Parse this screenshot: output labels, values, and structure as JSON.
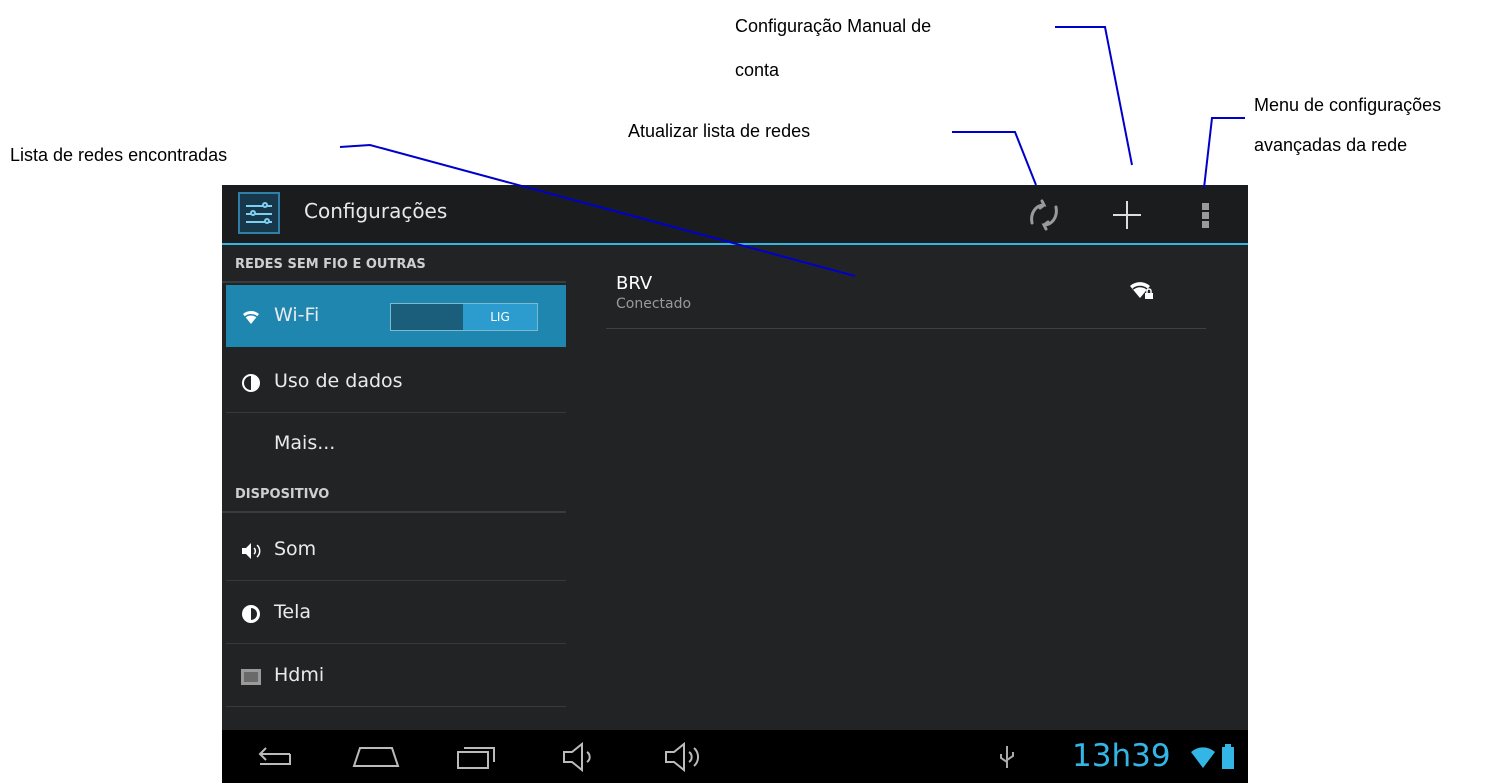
{
  "annotations": {
    "manual_config": "Configuração Manual de",
    "manual_config_line2": "conta",
    "refresh": "Atualizar lista de redes",
    "menu": "Menu de configurações",
    "menu_line2": "avançadas da rede",
    "network_list": "Lista de redes encontradas"
  },
  "action_bar": {
    "title": "Configurações",
    "icons": [
      "settings-app-icon",
      "refresh-icon",
      "add-icon",
      "overflow-menu-icon"
    ]
  },
  "sidebar": {
    "categories": [
      {
        "label": "REDES SEM FIO E OUTRAS"
      },
      {
        "label": "DISPOSITIVO"
      }
    ],
    "items": [
      {
        "label": "Wi-Fi",
        "icon": "wifi-icon",
        "selected": true,
        "toggle": "LIG"
      },
      {
        "label": "Uso de dados",
        "icon": "data-usage-icon"
      },
      {
        "label": "Mais..."
      },
      {
        "label": "Som",
        "icon": "speaker-icon"
      },
      {
        "label": "Tela",
        "icon": "display-brightness-icon"
      },
      {
        "label": "Hdmi",
        "icon": "hdmi-icon"
      }
    ]
  },
  "networks": [
    {
      "ssid": "BRV",
      "status": "Conectado",
      "icon": "wifi-locked-icon"
    }
  ],
  "status_bar": {
    "time": "13h39",
    "icons": [
      "back-icon",
      "home-icon",
      "recent-apps-icon",
      "volume-down-icon",
      "volume-up-icon",
      "usb-icon",
      "wifi-icon",
      "battery-icon"
    ]
  },
  "colors": {
    "accent": "#33b5e5",
    "selected_item": "#1f86b0",
    "background": "#222325",
    "callout_line": "#0000cc"
  }
}
